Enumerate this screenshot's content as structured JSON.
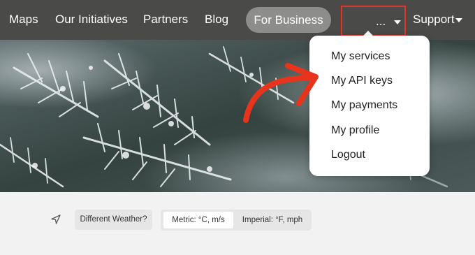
{
  "nav": {
    "maps": "Maps",
    "initiatives": "Our Initiatives",
    "partners": "Partners",
    "blog": "Blog",
    "for_business": "For Business",
    "more": "...",
    "support": "Support"
  },
  "dropdown": {
    "items": [
      {
        "label": "My services"
      },
      {
        "label": "My API keys"
      },
      {
        "label": "My payments"
      },
      {
        "label": "My profile"
      },
      {
        "label": "Logout"
      }
    ]
  },
  "controls": {
    "different_weather": "Different Weather?",
    "metric": "Metric: °C, m/s",
    "imperial": "Imperial: °F, mph"
  },
  "colors": {
    "nav_background": "#4a4a48",
    "business_pill": "#8d8d8b",
    "highlight_box": "#e2352a",
    "arrow": "#e8341c"
  },
  "icons": {
    "location": "location-arrow-icon",
    "annotation": "curved-arrow-annotation"
  }
}
